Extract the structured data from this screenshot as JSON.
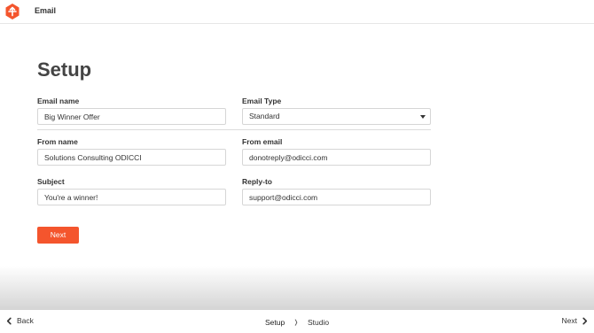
{
  "app": {
    "title": "Email",
    "brand_color": "#f4552d",
    "logo_icon": "diamond-plus-logo"
  },
  "page": {
    "title": "Setup"
  },
  "form": {
    "email_name": {
      "label": "Email name",
      "value": "Big Winner Offer"
    },
    "email_type": {
      "label": "Email Type",
      "value": "Standard"
    },
    "from_name": {
      "label": "From name",
      "value": "Solutions Consulting ODICCI"
    },
    "from_email": {
      "label": "From email",
      "value": "donotreply@odicci.com"
    },
    "subject": {
      "label": "Subject",
      "value": "You're a winner!"
    },
    "reply_to": {
      "label": "Reply-to",
      "value": "support@odicci.com"
    },
    "next_label": "Next"
  },
  "footer": {
    "back_label": "Back",
    "next_label": "Next",
    "steps": [
      "Setup",
      "Studio"
    ],
    "active_step": "Setup"
  }
}
